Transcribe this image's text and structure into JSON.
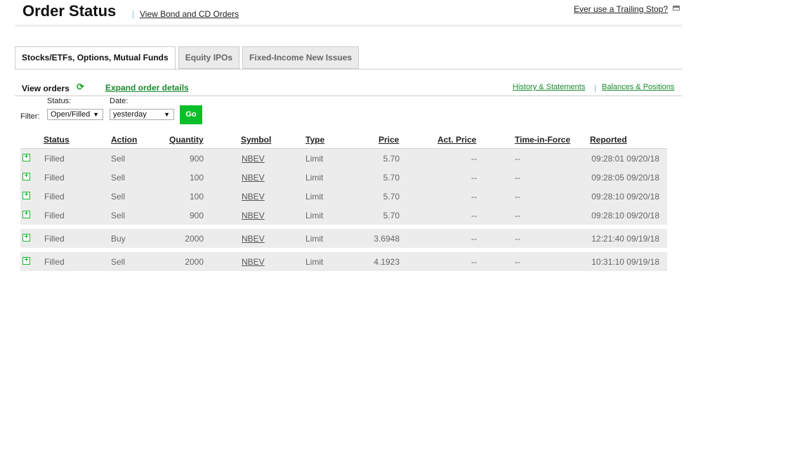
{
  "header": {
    "title": "Order Status",
    "bond_link": "View Bond and CD Orders",
    "trailing_link": "Ever use a Trailing Stop?",
    "separator": "|"
  },
  "tabs": [
    {
      "label": "Stocks/ETFs, Options, Mutual Funds",
      "active": true
    },
    {
      "label": "Equity IPOs"
    },
    {
      "label": "Fixed-Income New Issues"
    }
  ],
  "toolbar": {
    "view_orders": "View orders",
    "refresh_icon": "⟳",
    "expand": "Expand order details",
    "history": "History & Statements",
    "balances": "Balances & Positions"
  },
  "filter": {
    "label": "Filter:",
    "status_label": "Status:",
    "status_value": "Open/Filled",
    "date_label": "Date:",
    "date_value": "yesterday",
    "go": "Go",
    "arrow": "▼"
  },
  "columns": {
    "status": "Status",
    "action": "Action",
    "quantity": "Quantity",
    "symbol": "Symbol",
    "type": "Type",
    "price": "Price",
    "act_price": "Act. Price",
    "tif": "Time-in-Force",
    "reported": "Reported"
  },
  "groups": [
    [
      {
        "status": "Filled",
        "action": "Sell",
        "quantity": "900",
        "symbol": "NBEV",
        "type": "Limit",
        "price": "5.70",
        "act_price": "--",
        "tif": "--",
        "reported": "09:28:01 09/20/18"
      },
      {
        "status": "Filled",
        "action": "Sell",
        "quantity": "100",
        "symbol": "NBEV",
        "type": "Limit",
        "price": "5.70",
        "act_price": "--",
        "tif": "--",
        "reported": "09:28:05 09/20/18"
      },
      {
        "status": "Filled",
        "action": "Sell",
        "quantity": "100",
        "symbol": "NBEV",
        "type": "Limit",
        "price": "5.70",
        "act_price": "--",
        "tif": "--",
        "reported": "09:28:10 09/20/18"
      },
      {
        "status": "Filled",
        "action": "Sell",
        "quantity": "900",
        "symbol": "NBEV",
        "type": "Limit",
        "price": "5.70",
        "act_price": "--",
        "tif": "--",
        "reported": "09:28:10 09/20/18"
      }
    ],
    [
      {
        "status": "Filled",
        "action": "Buy",
        "quantity": "2000",
        "symbol": "NBEV",
        "type": "Limit",
        "price": "3.6948",
        "act_price": "--",
        "tif": "--",
        "reported": "12:21:40 09/19/18"
      }
    ],
    [
      {
        "status": "Filled",
        "action": "Sell",
        "quantity": "2000",
        "symbol": "NBEV",
        "type": "Limit",
        "price": "4.1923",
        "act_price": "--",
        "tif": "--",
        "reported": "10:31:10 09/19/18"
      }
    ]
  ],
  "colors": {
    "accent": "#1a8a2e",
    "go": "#0bbf2a",
    "row_bg": "#ececec"
  }
}
